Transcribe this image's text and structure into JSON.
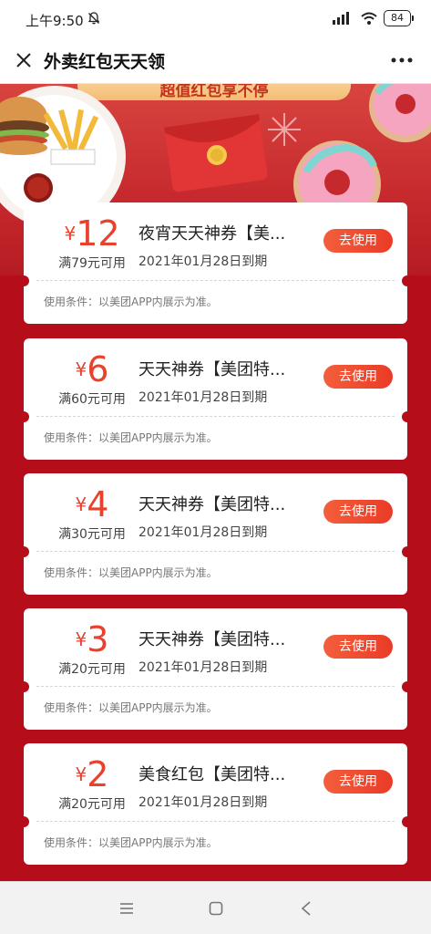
{
  "status_bar": {
    "time": "上午9:50",
    "battery": "84",
    "icons": [
      "bell-off-icon",
      "signal-icon",
      "wifi-icon",
      "battery-icon"
    ]
  },
  "title_bar": {
    "title": "外卖红包天天领",
    "close_icon": "close-icon",
    "more_icon": "more-icon"
  },
  "banner": {
    "headline": "超值红包享不停",
    "colors": {
      "red": "#c6292d",
      "gold": "#f3bd73"
    }
  },
  "coupons": [
    {
      "currency": "¥",
      "amount": "12",
      "threshold": "满79元可用",
      "name": "夜宵天天神券【美...",
      "expire": "2021年01月28日到期",
      "button": "去使用",
      "condition": "使用条件：以美团APP内展示为准。"
    },
    {
      "currency": "¥",
      "amount": "6",
      "threshold": "满60元可用",
      "name": "天天神券【美团特...",
      "expire": "2021年01月28日到期",
      "button": "去使用",
      "condition": "使用条件：以美团APP内展示为准。"
    },
    {
      "currency": "¥",
      "amount": "4",
      "threshold": "满30元可用",
      "name": "天天神券【美团特...",
      "expire": "2021年01月28日到期",
      "button": "去使用",
      "condition": "使用条件：以美团APP内展示为准。"
    },
    {
      "currency": "¥",
      "amount": "3",
      "threshold": "满20元可用",
      "name": "天天神券【美团特...",
      "expire": "2021年01月28日到期",
      "button": "去使用",
      "condition": "使用条件：以美团APP内展示为准。"
    },
    {
      "currency": "¥",
      "amount": "2",
      "threshold": "满20元可用",
      "name": "美食红包【美团特...",
      "expire": "2021年01月28日到期",
      "button": "去使用",
      "condition": "使用条件：以美团APP内展示为准。"
    }
  ],
  "nav_bar": {
    "icons": [
      "menu-icon",
      "home-icon",
      "back-icon"
    ]
  },
  "colors": {
    "page_bg": "#b50d1a",
    "accent": "#e8422e",
    "button_start": "#f35f3c",
    "button_end": "#ea3b27"
  }
}
